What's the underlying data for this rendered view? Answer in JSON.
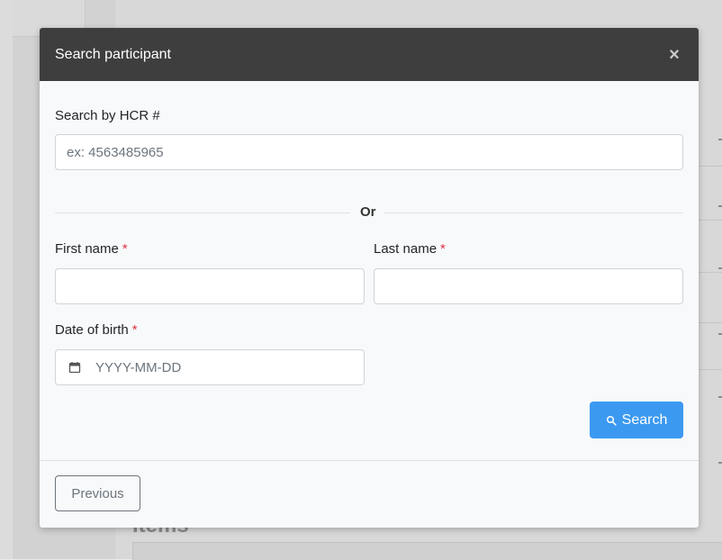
{
  "background": {
    "section_title": "Items"
  },
  "modal": {
    "title": "Search participant",
    "close_label": "×",
    "hcr": {
      "label": "Search by HCR #",
      "placeholder": "ex: 4563485965",
      "value": ""
    },
    "divider_text": "Or",
    "first_name": {
      "label": "First name",
      "required_mark": "*",
      "value": ""
    },
    "last_name": {
      "label": "Last name",
      "required_mark": "*",
      "value": ""
    },
    "dob": {
      "label": "Date of birth",
      "required_mark": "*",
      "placeholder": "YYYY-MM-DD",
      "icon": "calendar-icon"
    },
    "search_button": {
      "label": "Search",
      "icon": "search-icon"
    },
    "previous_button": {
      "label": "Previous"
    }
  },
  "colors": {
    "header_bg": "#3e3e3e",
    "primary": "#3b99f0",
    "required": "#dc3545"
  }
}
